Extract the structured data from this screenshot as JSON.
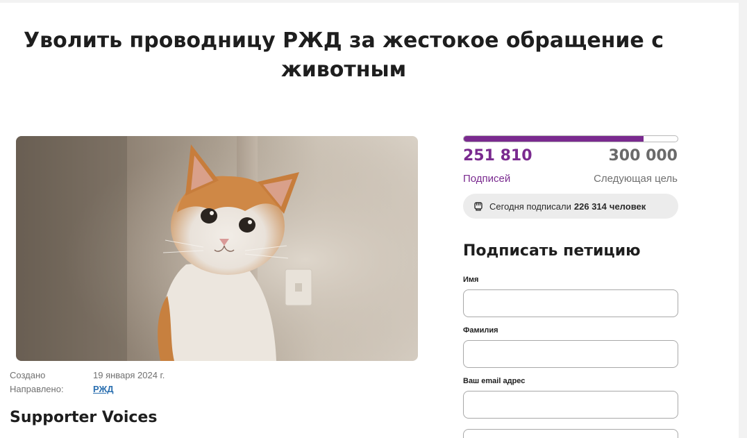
{
  "petition": {
    "title": "Уволить проводницу РЖД за жестокое обращение с животным"
  },
  "meta": {
    "created_label": "Создано",
    "created_value": "19 января 2024 г.",
    "addressed_label": "Направлено:",
    "addressed_value": "РЖД"
  },
  "supporters_heading": "Supporter Voices",
  "stats": {
    "signed_count": "251 810",
    "signed_label": "Подписей",
    "goal_count": "300 000",
    "goal_label": "Следующая цель",
    "progress_fraction": 0.8394,
    "today_prefix": "Сегодня подписали",
    "today_count": "226 314",
    "today_suffix": "человек",
    "accent_color": "#7a2a8f"
  },
  "form": {
    "title": "Подписать петицию",
    "first_name_label": "Имя",
    "last_name_label": "Фамилия",
    "email_label": "Ваш email адрес",
    "first_name_value": "",
    "last_name_value": "",
    "email_value": ""
  },
  "icons": {
    "today": "fist-icon",
    "photo": "cat-photo"
  }
}
